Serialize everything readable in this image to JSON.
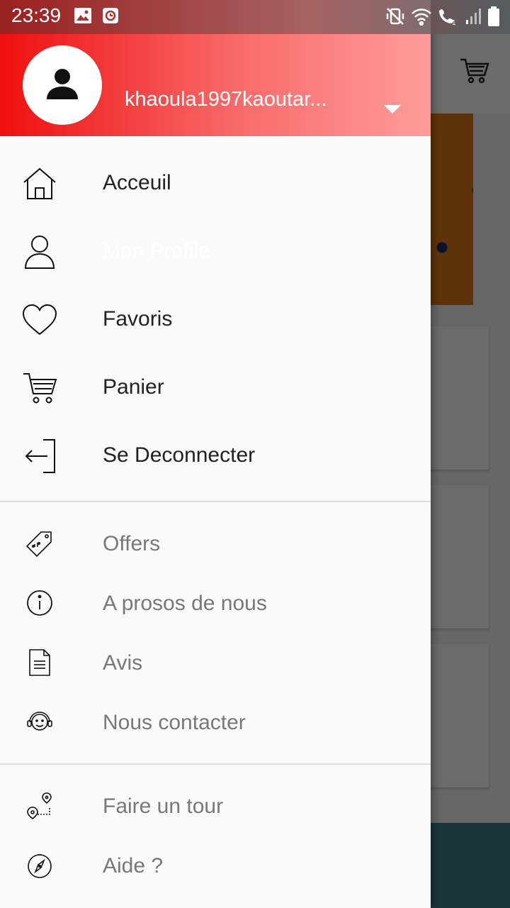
{
  "status_bar": {
    "time": "23:39"
  },
  "drawer": {
    "username": "khaoula1997kaoutar...",
    "primary_items": [
      {
        "label": "Acceuil",
        "icon": "home-icon"
      },
      {
        "label": "Mon Profile",
        "icon": "user-icon"
      },
      {
        "label": "Favoris",
        "icon": "heart-icon"
      },
      {
        "label": "Panier",
        "icon": "cart-icon"
      },
      {
        "label": "Se Deconnecter",
        "icon": "logout-icon"
      }
    ],
    "secondary_items": [
      {
        "label": "Offers",
        "icon": "tag-icon"
      },
      {
        "label": "A prosos de nous",
        "icon": "info-icon"
      },
      {
        "label": "Avis",
        "icon": "document-icon"
      },
      {
        "label": "Nous contacter",
        "icon": "support-icon"
      }
    ],
    "tertiary_items": [
      {
        "label": "Faire un tour",
        "icon": "route-icon"
      },
      {
        "label": "Aide ?",
        "icon": "compass-icon"
      }
    ]
  },
  "colors": {
    "header_start": "#ee0f0f",
    "header_end": "#ff9c9c",
    "primary_text": "#222222",
    "secondary_text": "#787878"
  }
}
